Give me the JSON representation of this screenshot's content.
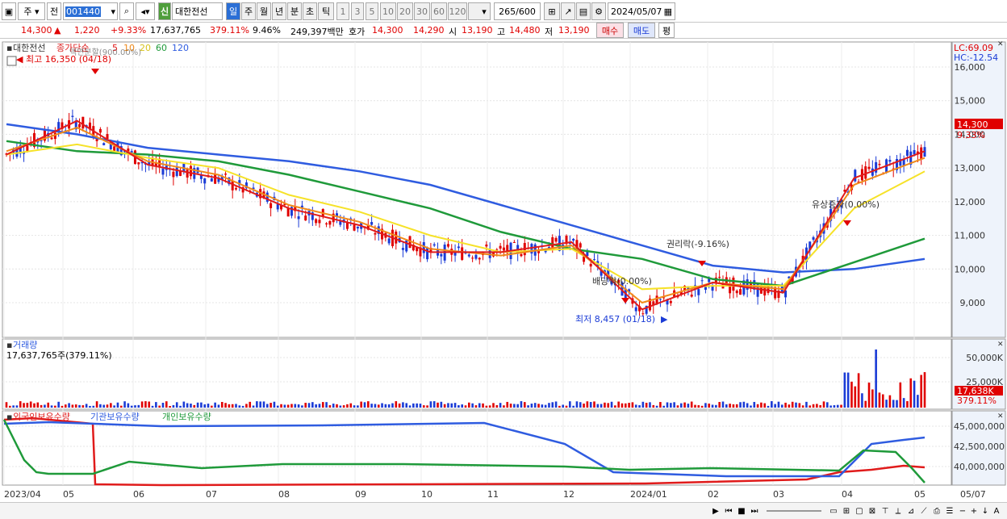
{
  "toolbar": {
    "market": "주",
    "scope": "전",
    "code": "001440",
    "badge": "신",
    "name": "대한전선",
    "periods": [
      "일",
      "주",
      "월",
      "년",
      "분",
      "초",
      "틱"
    ],
    "active_period": "일",
    "intervals": [
      "1",
      "3",
      "5",
      "10",
      "20",
      "30",
      "60",
      "120"
    ],
    "count": "265",
    "total": "/600",
    "date": "2024/05/07"
  },
  "quote": {
    "price": "14,300",
    "change": "1,220",
    "change_pct": "+9.33%",
    "volume": "17,637,765",
    "vol_ratio": "379.11%",
    "turnover": "9.46%",
    "amount": "249,397백만",
    "bid_label": "호가",
    "ask": "14,300",
    "bid": "14,290",
    "open_label": "시",
    "open": "13,190",
    "high_label": "고",
    "high": "14,480",
    "low_label": "저",
    "low": "13,190",
    "buy_label": "매수",
    "sell_label": "매도",
    "eval_label": "평"
  },
  "price_panel": {
    "title": "대한전선",
    "ma_label": "종가단순",
    "ma_periods": [
      "5",
      "10",
      "20",
      "60",
      "120"
    ],
    "lc": "LC:69.09",
    "hc": "HC:-12.54",
    "y_ticks": [
      "16,000",
      "15,000",
      "14,000",
      "13,000",
      "12,000",
      "11,000",
      "10,000",
      "9,000"
    ],
    "current_price": "14,300",
    "current_pct": "9.33%",
    "annotations": {
      "high": "최고 16,350 (04/18)",
      "low": "최저 8,457 (01/18)",
      "dividend_left": "액면분할(900.00%)",
      "dividend": "배당락(0.00%)",
      "rights": "권리락(-9.16%)",
      "capital": "유상증자(0.00%)"
    }
  },
  "volume_panel": {
    "title": "거래량",
    "value": "17,637,765주(379.11%)",
    "y_ticks": [
      "50,000K",
      "25,000K"
    ],
    "current": "17,638K",
    "current_pct": "379.11%"
  },
  "holdings_panel": {
    "legend": [
      "외국인보유수량",
      "기관보유수량",
      "개인보유수량"
    ],
    "y_ticks": [
      "45,000,000",
      "42,500,000",
      "40,000,000"
    ]
  },
  "x_axis": {
    "labels": [
      "2023/04",
      "05",
      "06",
      "07",
      "08",
      "09",
      "10",
      "11",
      "12",
      "2024/01",
      "02",
      "03",
      "04",
      "05"
    ],
    "right_label": "05/07"
  },
  "colors": {
    "ma5": "#e01b1b",
    "ma10": "#f08a1a",
    "ma20": "#f6e229",
    "ma60": "#1f9a3a",
    "ma120": "#2f5ce0",
    "up": "#e00000",
    "down": "#1a3bd6"
  },
  "chart_data": {
    "type": "line",
    "x": [
      "2023/04",
      "05",
      "06",
      "07",
      "08",
      "09",
      "10",
      "11",
      "12",
      "2024/01",
      "02",
      "03",
      "04",
      "05"
    ],
    "series": [
      {
        "name": "5",
        "values": [
          13400,
          14400,
          13100,
          12700,
          11800,
          11300,
          10500,
          10500,
          10800,
          8800,
          9600,
          9300,
          12700,
          13500
        ]
      },
      {
        "name": "10",
        "values": [
          13500,
          14200,
          13200,
          12800,
          11900,
          11400,
          10600,
          10400,
          10700,
          9000,
          9600,
          9400,
          12500,
          13300
        ]
      },
      {
        "name": "20",
        "values": [
          13400,
          13700,
          13300,
          13000,
          12200,
          11700,
          11000,
          10500,
          10600,
          9400,
          9500,
          9500,
          11800,
          12900
        ]
      },
      {
        "name": "60",
        "values": [
          13800,
          13500,
          13400,
          13200,
          12800,
          12300,
          11800,
          11100,
          10600,
          10300,
          9700,
          9500,
          10200,
          10900
        ]
      },
      {
        "name": "120",
        "values": [
          14300,
          14000,
          13600,
          13400,
          13200,
          12900,
          12500,
          11900,
          11300,
          10700,
          10100,
          9900,
          10000,
          10300
        ]
      }
    ],
    "ylim": [
      8000,
      16400
    ]
  }
}
